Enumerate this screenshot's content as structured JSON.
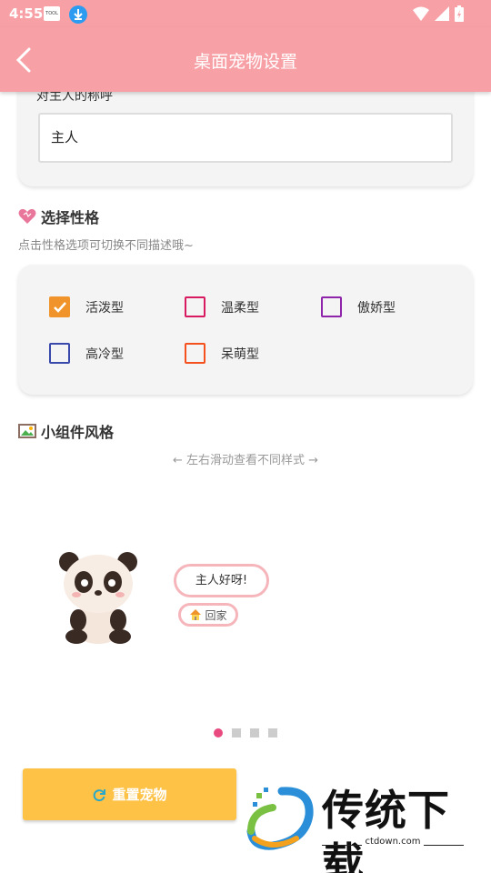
{
  "status_bar": {
    "time": "4:55",
    "notif_label": "TOOL"
  },
  "app_bar": {
    "title": "桌面宠物设置",
    "back_icon": "chevron-left-icon"
  },
  "name_section": {
    "label": "对主人的称呼",
    "input_value": "主人"
  },
  "personality": {
    "title": "选择性格",
    "icon": "heart-icon",
    "subtitle": "点击性格选项可切换不同描述哦~",
    "options": [
      {
        "label": "活泼型",
        "checked": true,
        "color": "#f0932b"
      },
      {
        "label": "温柔型",
        "checked": false,
        "color": "#d81b60"
      },
      {
        "label": "傲娇型",
        "checked": false,
        "color": "#8e24aa"
      },
      {
        "label": "高冷型",
        "checked": false,
        "color": "#3949ab"
      },
      {
        "label": "呆萌型",
        "checked": false,
        "color": "#f4511e"
      }
    ]
  },
  "widget_style": {
    "title": "小组件风格",
    "icon": "picture-frame-icon",
    "hint": "← 左右滑动查看不同样式 →",
    "bubble_text": "主人好呀!",
    "home_label": "回家",
    "home_icon": "house-icon",
    "page_count": 4,
    "active_page": 1
  },
  "reset_button": {
    "label": "重置宠物",
    "icon": "refresh-icon",
    "color": "#fdc246"
  },
  "watermark": {
    "text": "传统下载",
    "url": "ctdown.com"
  },
  "colors": {
    "accent": "#f7a1a7",
    "dot_active": "#e84a7f"
  }
}
